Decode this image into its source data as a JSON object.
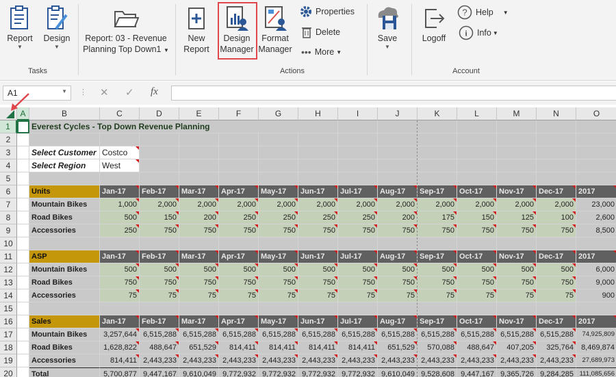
{
  "ribbon": {
    "report_label": "Report",
    "design_label": "Design",
    "report_selector": {
      "line1": "Report: 03 - Revenue",
      "line2": "Planning Top Down1"
    },
    "new_report": {
      "line1": "New",
      "line2": "Report"
    },
    "design_manager": {
      "line1": "Design",
      "line2": "Manager"
    },
    "format_manager": {
      "line1": "Format",
      "line2": "Manager"
    },
    "properties_label": "Properties",
    "delete_label": "Delete",
    "more_label": "More",
    "save_label": "Save",
    "logoff_label": "Logoff",
    "help_label": "Help",
    "info_label": "Info",
    "groups": {
      "tasks": "Tasks",
      "actions": "Actions",
      "account": "Account"
    }
  },
  "formula_bar": {
    "name_box": "A1",
    "cancel": "✕",
    "enter": "✓",
    "fx": "fx",
    "value": ""
  },
  "columns": [
    "A",
    "B",
    "C",
    "D",
    "E",
    "F",
    "G",
    "H",
    "I",
    "J",
    "K",
    "L",
    "M",
    "N",
    "O"
  ],
  "rows": [
    "1",
    "2",
    "3",
    "4",
    "5",
    "6",
    "7",
    "8",
    "9",
    "10",
    "11",
    "12",
    "13",
    "14",
    "15",
    "16",
    "17",
    "18",
    "19",
    "20"
  ],
  "sheet": {
    "title": "Everest Cycles - Top Down Revenue Planning",
    "select_customer_label": "Select Customer",
    "select_customer_value": "Costco",
    "select_region_label": "Select Region",
    "select_region_value": "West",
    "months": [
      "Jan-17",
      "Feb-17",
      "Mar-17",
      "Apr-17",
      "May-17",
      "Jun-17",
      "Jul-17",
      "Aug-17",
      "Sep-17",
      "Oct-17",
      "Nov-17",
      "Dec-17",
      "2017"
    ],
    "sections": [
      {
        "label": "Units",
        "rows": [
          {
            "label": "Mountain Bikes",
            "values": [
              "1,000",
              "2,000",
              "2,000",
              "2,000",
              "2,000",
              "2,000",
              "2,000",
              "2,000",
              "2,000",
              "2,000",
              "2,000",
              "2,000",
              "23,000"
            ]
          },
          {
            "label": "Road Bikes",
            "values": [
              "500",
              "150",
              "200",
              "250",
              "250",
              "250",
              "250",
              "200",
              "175",
              "150",
              "125",
              "100",
              "2,600"
            ]
          },
          {
            "label": "Accessories",
            "values": [
              "250",
              "750",
              "750",
              "750",
              "750",
              "750",
              "750",
              "750",
              "750",
              "750",
              "750",
              "750",
              "8,500"
            ]
          }
        ]
      },
      {
        "label": "ASP",
        "rows": [
          {
            "label": "Mountain Bikes",
            "values": [
              "500",
              "500",
              "500",
              "500",
              "500",
              "500",
              "500",
              "500",
              "500",
              "500",
              "500",
              "500",
              "6,000"
            ]
          },
          {
            "label": "Road Bikes",
            "values": [
              "750",
              "750",
              "750",
              "750",
              "750",
              "750",
              "750",
              "750",
              "750",
              "750",
              "750",
              "750",
              "9,000"
            ]
          },
          {
            "label": "Accessories",
            "values": [
              "75",
              "75",
              "75",
              "75",
              "75",
              "75",
              "75",
              "75",
              "75",
              "75",
              "75",
              "75",
              "900"
            ]
          }
        ]
      },
      {
        "label": "Sales",
        "rows": [
          {
            "label": "Mountain Bikes",
            "values": [
              "3,257,644",
              "6,515,288",
              "6,515,288",
              "6,515,288",
              "6,515,288",
              "6,515,288",
              "6,515,288",
              "6,515,288",
              "6,515,288",
              "6,515,288",
              "6,515,288",
              "6,515,288",
              "74,925,809"
            ]
          },
          {
            "label": "Road Bikes",
            "values": [
              "1,628,822",
              "488,647",
              "651,529",
              "814,411",
              "814,411",
              "814,411",
              "814,411",
              "651,529",
              "570,088",
              "488,647",
              "407,205",
              "325,764",
              "8,469,874"
            ]
          },
          {
            "label": "Accessories",
            "values": [
              "814,411",
              "2,443,233",
              "2,443,233",
              "2,443,233",
              "2,443,233",
              "2,443,233",
              "2,443,233",
              "2,443,233",
              "2,443,233",
              "2,443,233",
              "2,443,233",
              "2,443,233",
              "27,689,973"
            ]
          },
          {
            "label": "Total",
            "values": [
              "5,700,877",
              "9,447,167",
              "9,610,049",
              "9,772,932",
              "9,772,932",
              "9,772,932",
              "9,772,932",
              "9,610,049",
              "9,528,608",
              "9,447,167",
              "9,365,726",
              "9,284,285",
              "111,085,656"
            ]
          }
        ]
      }
    ]
  }
}
